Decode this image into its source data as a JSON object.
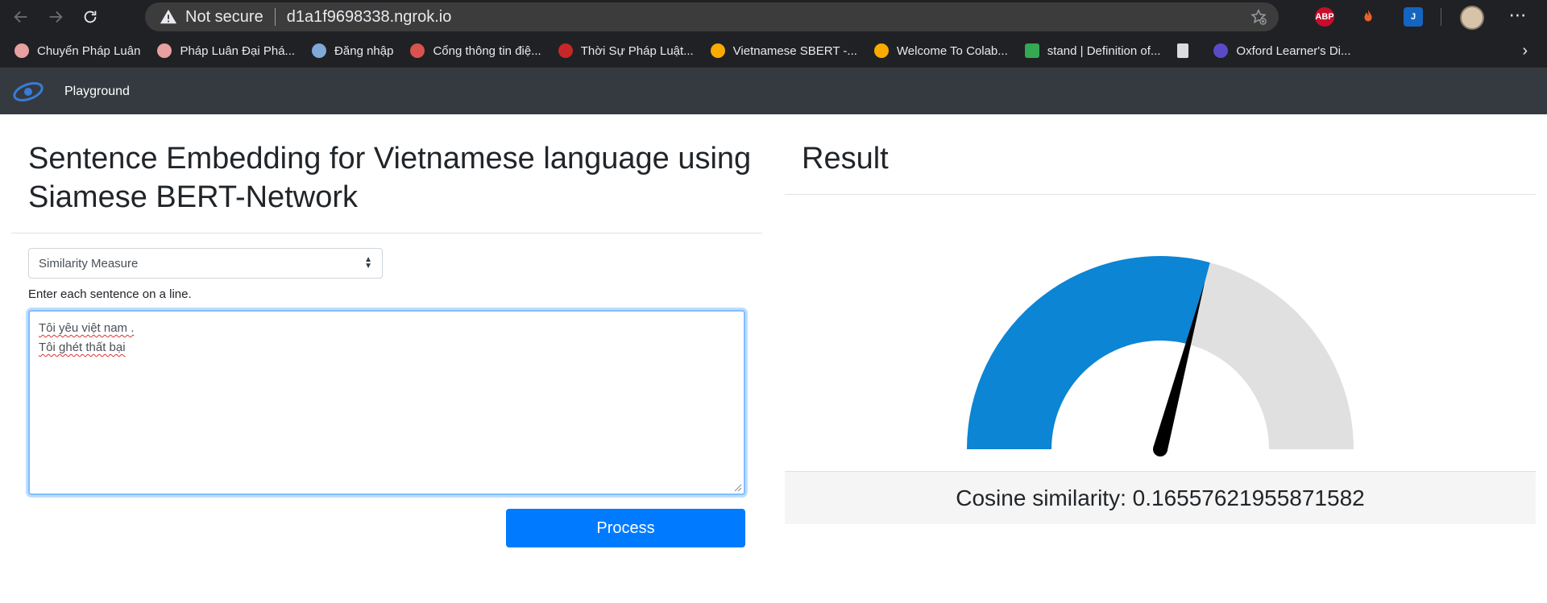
{
  "browser": {
    "security_label": "Not secure",
    "url": "d1a1f9698338.ngrok.io",
    "extensions": [
      {
        "name": "adblock-plus-icon",
        "label": "ABP",
        "color": "#c70d2c"
      },
      {
        "name": "fire-extension-icon",
        "label": "",
        "color": "#e8642c"
      },
      {
        "name": "j-extension-icon",
        "label": "J",
        "color": "#1565c0"
      }
    ],
    "menu_glyph": "⋯"
  },
  "bookmarks": [
    {
      "label": "Chuyển Pháp Luân",
      "fav_color": "#e8a0a0"
    },
    {
      "label": "Pháp Luân Đại Phá...",
      "fav_color": "#e8a0a0"
    },
    {
      "label": "Đăng nhập",
      "fav_color": "#7fa9d6"
    },
    {
      "label": "Cổng thông tin điệ...",
      "fav_color": "#d9534f"
    },
    {
      "label": "Thời Sự Pháp Luật...",
      "fav_color": "#c62828"
    },
    {
      "label": "Vietnamese SBERT -...",
      "fav_color": "#f9ab00"
    },
    {
      "label": "Welcome To Colab...",
      "fav_color": "#f9ab00"
    },
    {
      "label": "stand | Definition of...",
      "fav_color": "#34a853"
    },
    {
      "label": "",
      "fav_color": "#dadce0"
    },
    {
      "label": "Oxford Learner's Di...",
      "fav_color": "#5b4ac7"
    }
  ],
  "app": {
    "nav_link": "Playground",
    "title": "Sentence Embedding for Vietnamese language using Siamese BERT-Network",
    "select_value": "Similarity Measure",
    "hint": "Enter each sentence on a line.",
    "input_lines": [
      "Tôi yêu việt nam .",
      "Tôi ghét thất bại"
    ],
    "process_label": "Process",
    "result_title": "Result",
    "cosine_label": "Cosine similarity: 0.1655762195587158 2"
  },
  "gauge": {
    "value": 0.1655762195587158,
    "min": -1,
    "max": 1,
    "fill_color": "#0b85d4",
    "track_color": "#e0e0e0",
    "needle_color": "#000000"
  },
  "colors": {
    "primary": "#007bff",
    "navbar": "#343a40",
    "chrome": "#202124"
  }
}
